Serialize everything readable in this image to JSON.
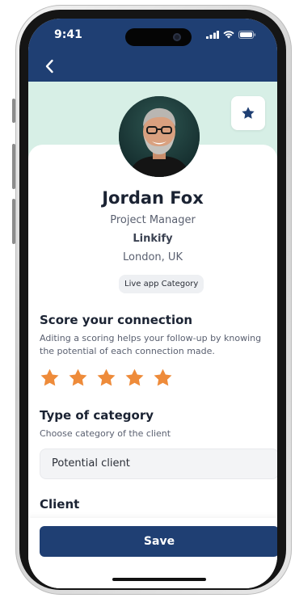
{
  "status_bar": {
    "time": "9:41"
  },
  "colors": {
    "primary": "#1f3f73",
    "mint": "#d7efe6",
    "star": "#ee8b3a"
  },
  "nav": {
    "back_icon": "chevron-left-icon",
    "favorite_icon": "star-icon"
  },
  "profile": {
    "name": "Jordan Fox",
    "role": "Project Manager",
    "company": "Linkify",
    "location": "London, UK",
    "tag": "Live app Category"
  },
  "score": {
    "title": "Score your connection",
    "description": "Aditing a scoring helps your follow-up by knowing the potential of each connection made.",
    "rating": 5,
    "max_rating": 5
  },
  "category": {
    "title": "Type of category",
    "description": "Choose category of the client",
    "selected": "Potential client"
  },
  "client": {
    "title": "Client"
  },
  "actions": {
    "save_label": "Save"
  }
}
